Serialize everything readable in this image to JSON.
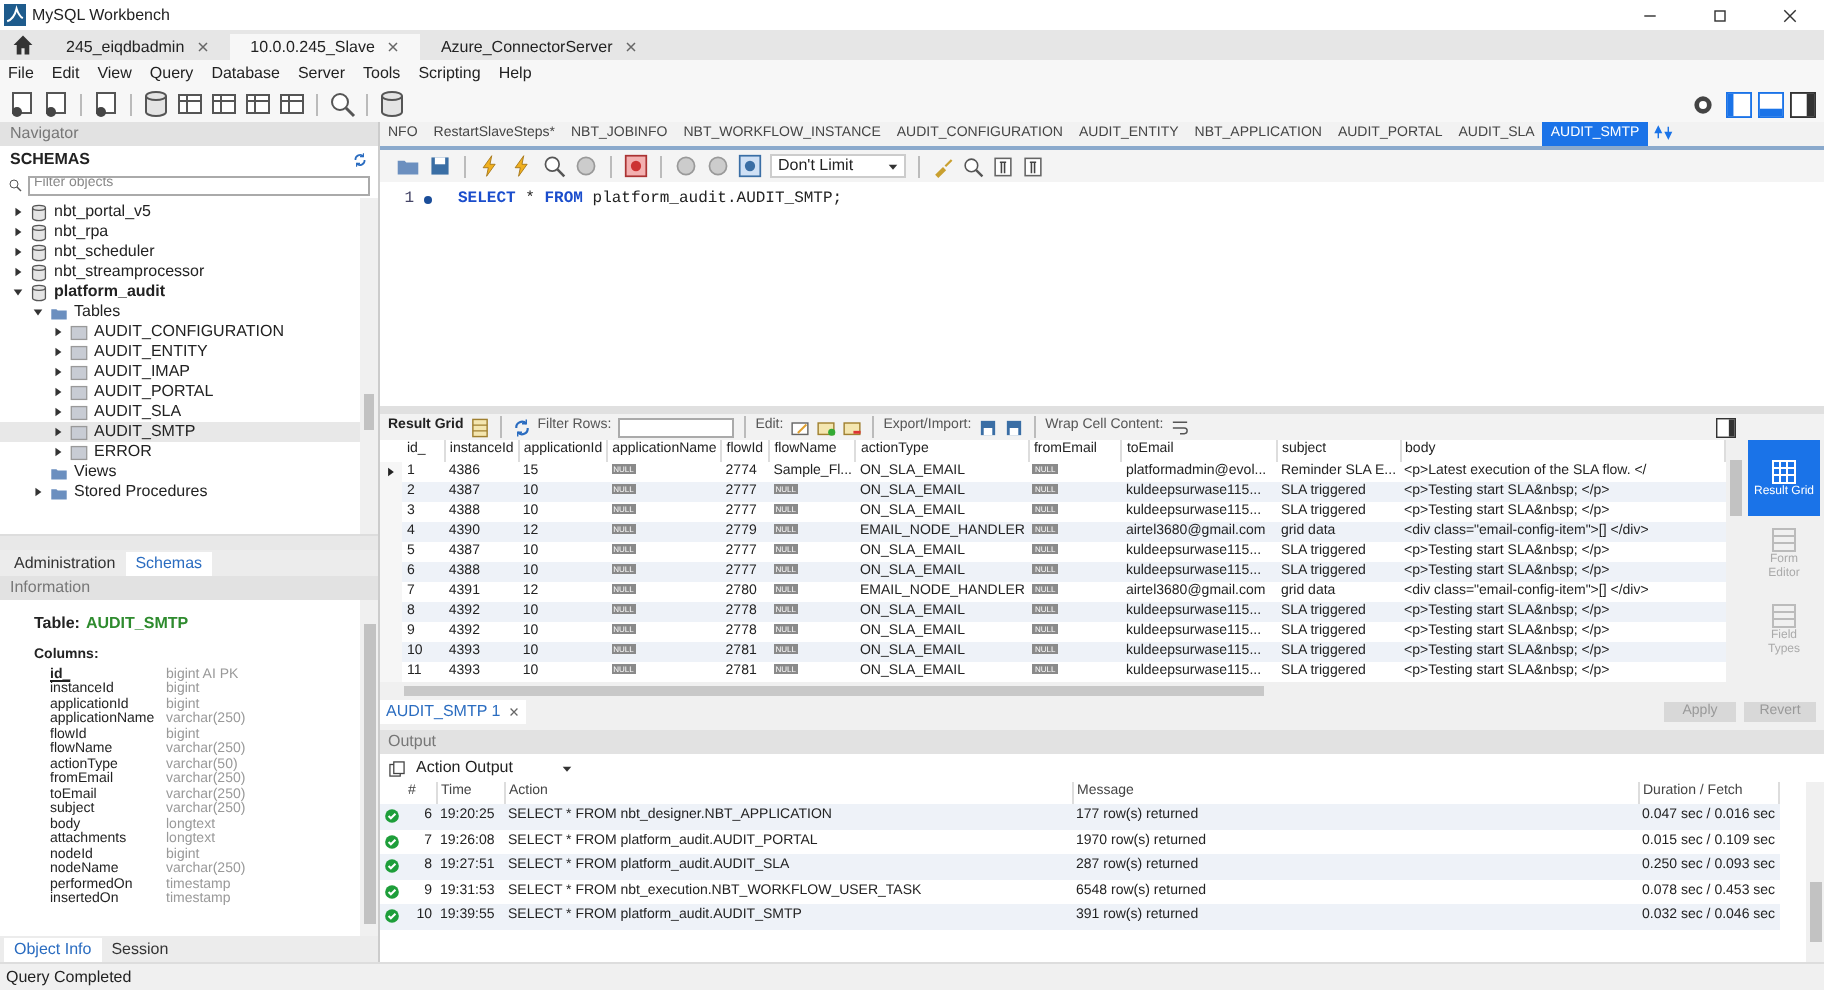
{
  "window": {
    "title": "MySQL Workbench"
  },
  "connection_tabs": [
    {
      "label": "245_eiqdbadmin",
      "selected": false
    },
    {
      "label": "10.0.0.245_Slave",
      "selected": true
    },
    {
      "label": "Azure_ConnectorServer",
      "selected": false
    }
  ],
  "menu": [
    "File",
    "Edit",
    "View",
    "Query",
    "Database",
    "Server",
    "Tools",
    "Scripting",
    "Help"
  ],
  "navigator": {
    "title": "Navigator",
    "schemas_label": "SCHEMAS",
    "filter_placeholder": "Filter objects",
    "tree": [
      {
        "label": "nbt_portal_v5",
        "kind": "schema",
        "expandable": true,
        "expanded": false,
        "default": false,
        "selected": false
      },
      {
        "label": "nbt_rpa",
        "kind": "schema",
        "expandable": true,
        "expanded": false,
        "default": false,
        "selected": false
      },
      {
        "label": "nbt_scheduler",
        "kind": "schema",
        "expandable": true,
        "expanded": false,
        "default": false,
        "selected": false
      },
      {
        "label": "nbt_streamprocessor",
        "kind": "schema",
        "expandable": true,
        "expanded": false,
        "default": false,
        "selected": false
      },
      {
        "label": "platform_audit",
        "kind": "schema",
        "expandable": true,
        "expanded": true,
        "default": true,
        "selected": false,
        "children": [
          {
            "label": "Tables",
            "kind": "folder",
            "expandable": true,
            "expanded": true,
            "default": false,
            "selected": false,
            "children": [
              {
                "label": "AUDIT_CONFIGURATION",
                "kind": "table",
                "expandable": true,
                "expanded": false,
                "default": false,
                "selected": false
              },
              {
                "label": "AUDIT_ENTITY",
                "kind": "table",
                "expandable": true,
                "expanded": false,
                "default": false,
                "selected": false
              },
              {
                "label": "AUDIT_IMAP",
                "kind": "table",
                "expandable": true,
                "expanded": false,
                "default": false,
                "selected": false
              },
              {
                "label": "AUDIT_PORTAL",
                "kind": "table",
                "expandable": true,
                "expanded": false,
                "default": false,
                "selected": false
              },
              {
                "label": "AUDIT_SLA",
                "kind": "table",
                "expandable": true,
                "expanded": false,
                "default": false,
                "selected": false
              },
              {
                "label": "AUDIT_SMTP",
                "kind": "table",
                "expandable": true,
                "expanded": false,
                "default": false,
                "selected": true
              },
              {
                "label": "ERROR",
                "kind": "table",
                "expandable": true,
                "expanded": false,
                "default": false,
                "selected": false
              }
            ]
          },
          {
            "label": "Views",
            "kind": "folder",
            "expandable": false,
            "default": false,
            "selected": false
          },
          {
            "label": "Stored Procedures",
            "kind": "folder",
            "expandable": true,
            "expanded": false,
            "default": false,
            "selected": false
          }
        ]
      }
    ],
    "bottom_tabs": [
      {
        "label": "Administration",
        "selected": false
      },
      {
        "label": "Schemas",
        "selected": true
      }
    ]
  },
  "information": {
    "title": "Information",
    "table_label": "Table:",
    "table_name": "AUDIT_SMTP",
    "columns_label": "Columns:",
    "columns": [
      {
        "name": "id_",
        "type": "bigint AI PK",
        "primary_key": true
      },
      {
        "name": "instanceId",
        "type": "bigint",
        "primary_key": false
      },
      {
        "name": "applicationId",
        "type": "bigint",
        "primary_key": false
      },
      {
        "name": "applicationName",
        "type": "varchar(250)",
        "primary_key": false
      },
      {
        "name": "flowId",
        "type": "bigint",
        "primary_key": false
      },
      {
        "name": "flowName",
        "type": "varchar(250)",
        "primary_key": false
      },
      {
        "name": "actionType",
        "type": "varchar(50)",
        "primary_key": false
      },
      {
        "name": "fromEmail",
        "type": "varchar(250)",
        "primary_key": false
      },
      {
        "name": "toEmail",
        "type": "varchar(250)",
        "primary_key": false
      },
      {
        "name": "subject",
        "type": "varchar(250)",
        "primary_key": false
      },
      {
        "name": "body",
        "type": "longtext",
        "primary_key": false
      },
      {
        "name": "attachments",
        "type": "longtext",
        "primary_key": false
      },
      {
        "name": "nodeId",
        "type": "bigint",
        "primary_key": false
      },
      {
        "name": "nodeName",
        "type": "varchar(250)",
        "primary_key": false
      },
      {
        "name": "performedOn",
        "type": "timestamp",
        "primary_key": false
      },
      {
        "name": "insertedOn",
        "type": "timestamp",
        "primary_key": false
      }
    ],
    "bottom_tabs": [
      {
        "label": "Object Info",
        "selected": true
      },
      {
        "label": "Session",
        "selected": false
      }
    ]
  },
  "editor_tabs": [
    {
      "label": "NFO",
      "selected": false
    },
    {
      "label": "RestartSlaveSteps*",
      "selected": false
    },
    {
      "label": "NBT_JOBINFO",
      "selected": false
    },
    {
      "label": "NBT_WORKFLOW_INSTANCE",
      "selected": false
    },
    {
      "label": "AUDIT_CONFIGURATION",
      "selected": false
    },
    {
      "label": "AUDIT_ENTITY",
      "selected": false
    },
    {
      "label": "NBT_APPLICATION",
      "selected": false
    },
    {
      "label": "AUDIT_PORTAL",
      "selected": false
    },
    {
      "label": "AUDIT_SLA",
      "selected": false
    },
    {
      "label": "AUDIT_SMTP",
      "selected": true
    }
  ],
  "query_toolbar": {
    "limit": "Don't Limit"
  },
  "editor": {
    "lines": [
      {
        "number": "1",
        "tokens": [
          {
            "text": "SELECT",
            "kind": "keyword"
          },
          {
            "text": "*",
            "kind": "plain"
          },
          {
            "text": "FROM",
            "kind": "keyword"
          },
          {
            "text": "platform_audit.AUDIT_SMTP;",
            "kind": "plain"
          }
        ]
      }
    ]
  },
  "result": {
    "toolbar": {
      "grid_label": "Result Grid",
      "filter_label": "Filter Rows:",
      "edit_label": "Edit:",
      "export_label": "Export/Import:",
      "wrap_label": "Wrap Cell Content:"
    },
    "columns": [
      "id_",
      "instanceId",
      "applicationId",
      "applicationName",
      "flowId",
      "flowName",
      "actionType",
      "fromEmail",
      "toEmail",
      "subject",
      "body"
    ],
    "rows": [
      {
        "current": true,
        "cells": [
          "1",
          "4386",
          "15",
          {
            "null": true,
            "text": "NULL"
          },
          "2774",
          "Sample_Fl...",
          "ON_SLA_EMAIL",
          {
            "null": true,
            "text": "NULL"
          },
          "platformadmin@evol...",
          "Reminder SLA E...",
          "<p>Latest execution of the SLA flow. </"
        ]
      },
      {
        "current": false,
        "cells": [
          "2",
          "4387",
          "10",
          {
            "null": true,
            "text": "NULL"
          },
          "2777",
          {
            "null": true,
            "text": "NULL"
          },
          "ON_SLA_EMAIL",
          {
            "null": true,
            "text": "NULL"
          },
          "kuldeepsurwase115...",
          "SLA triggered",
          "<p>Testing start SLA&nbsp; </p>"
        ]
      },
      {
        "current": false,
        "cells": [
          "3",
          "4388",
          "10",
          {
            "null": true,
            "text": "NULL"
          },
          "2777",
          {
            "null": true,
            "text": "NULL"
          },
          "ON_SLA_EMAIL",
          {
            "null": true,
            "text": "NULL"
          },
          "kuldeepsurwase115...",
          "SLA triggered",
          "<p>Testing start SLA&nbsp; </p>"
        ]
      },
      {
        "current": false,
        "cells": [
          "4",
          "4390",
          "12",
          {
            "null": true,
            "text": "NULL"
          },
          "2779",
          {
            "null": true,
            "text": "NULL"
          },
          "EMAIL_NODE_HANDLER",
          {
            "null": true,
            "text": "NULL"
          },
          "airtel3680@gmail.com",
          "grid data",
          "<div class=\"email-config-item\">[] </div>"
        ]
      },
      {
        "current": false,
        "cells": [
          "5",
          "4387",
          "10",
          {
            "null": true,
            "text": "NULL"
          },
          "2777",
          {
            "null": true,
            "text": "NULL"
          },
          "ON_SLA_EMAIL",
          {
            "null": true,
            "text": "NULL"
          },
          "kuldeepsurwase115...",
          "SLA triggered",
          "<p>Testing start SLA&nbsp; </p>"
        ]
      },
      {
        "current": false,
        "cells": [
          "6",
          "4388",
          "10",
          {
            "null": true,
            "text": "NULL"
          },
          "2777",
          {
            "null": true,
            "text": "NULL"
          },
          "ON_SLA_EMAIL",
          {
            "null": true,
            "text": "NULL"
          },
          "kuldeepsurwase115...",
          "SLA triggered",
          "<p>Testing start SLA&nbsp; </p>"
        ]
      },
      {
        "current": false,
        "cells": [
          "7",
          "4391",
          "12",
          {
            "null": true,
            "text": "NULL"
          },
          "2780",
          {
            "null": true,
            "text": "NULL"
          },
          "EMAIL_NODE_HANDLER",
          {
            "null": true,
            "text": "NULL"
          },
          "airtel3680@gmail.com",
          "grid data",
          "<div class=\"email-config-item\">[] </div>"
        ]
      },
      {
        "current": false,
        "cells": [
          "8",
          "4392",
          "10",
          {
            "null": true,
            "text": "NULL"
          },
          "2778",
          {
            "null": true,
            "text": "NULL"
          },
          "ON_SLA_EMAIL",
          {
            "null": true,
            "text": "NULL"
          },
          "kuldeepsurwase115...",
          "SLA triggered",
          "<p>Testing start SLA&nbsp; </p>"
        ]
      },
      {
        "current": false,
        "cells": [
          "9",
          "4392",
          "10",
          {
            "null": true,
            "text": "NULL"
          },
          "2778",
          {
            "null": true,
            "text": "NULL"
          },
          "ON_SLA_EMAIL",
          {
            "null": true,
            "text": "NULL"
          },
          "kuldeepsurwase115...",
          "SLA triggered",
          "<p>Testing start SLA&nbsp; </p>"
        ]
      },
      {
        "current": false,
        "cells": [
          "10",
          "4393",
          "10",
          {
            "null": true,
            "text": "NULL"
          },
          "2781",
          {
            "null": true,
            "text": "NULL"
          },
          "ON_SLA_EMAIL",
          {
            "null": true,
            "text": "NULL"
          },
          "kuldeepsurwase115...",
          "SLA triggered",
          "<p>Testing start SLA&nbsp; </p>"
        ]
      },
      {
        "current": false,
        "cells": [
          "11",
          "4393",
          "10",
          {
            "null": true,
            "text": "NULL"
          },
          "2781",
          {
            "null": true,
            "text": "NULL"
          },
          "ON_SLA_EMAIL",
          {
            "null": true,
            "text": "NULL"
          },
          "kuldeepsurwase115...",
          "SLA triggered",
          "<p>Testing start SLA&nbsp; </p>"
        ]
      }
    ],
    "side_panel": [
      {
        "label": "Result Grid",
        "selected": true
      },
      {
        "label": "Form Editor",
        "selected": false
      },
      {
        "label": "Field Types",
        "selected": false
      }
    ],
    "result_tabs": [
      {
        "label": "AUDIT_SMTP 1",
        "selected": true
      }
    ],
    "buttons": [
      {
        "label": "Apply",
        "disabled": true
      },
      {
        "label": "Revert",
        "disabled": true
      }
    ]
  },
  "output": {
    "title": "Output",
    "selector": "Action Output",
    "columns": [
      "#",
      "Time",
      "Action",
      "Message",
      "Duration / Fetch"
    ],
    "rows": [
      {
        "success": true,
        "cells": [
          "6",
          "19:20:25",
          "SELECT * FROM nbt_designer.NBT_APPLICATION",
          "177 row(s) returned",
          "0.047 sec / 0.016 sec"
        ]
      },
      {
        "success": true,
        "cells": [
          "7",
          "19:26:08",
          "SELECT * FROM platform_audit.AUDIT_PORTAL",
          "1970 row(s) returned",
          "0.015 sec / 0.109 sec"
        ]
      },
      {
        "success": true,
        "cells": [
          "8",
          "19:27:51",
          "SELECT * FROM platform_audit.AUDIT_SLA",
          "287 row(s) returned",
          "0.250 sec / 0.093 sec"
        ]
      },
      {
        "success": true,
        "cells": [
          "9",
          "19:31:53",
          "SELECT * FROM nbt_execution.NBT_WORKFLOW_USER_TASK",
          "6548 row(s) returned",
          "0.078 sec / 0.453 sec"
        ]
      },
      {
        "success": true,
        "cells": [
          "10",
          "19:39:55",
          "SELECT * FROM platform_audit.AUDIT_SMTP",
          "391 row(s) returned",
          "0.032 sec / 0.046 sec"
        ]
      }
    ]
  },
  "status_bar": {
    "text": "Query Completed"
  }
}
